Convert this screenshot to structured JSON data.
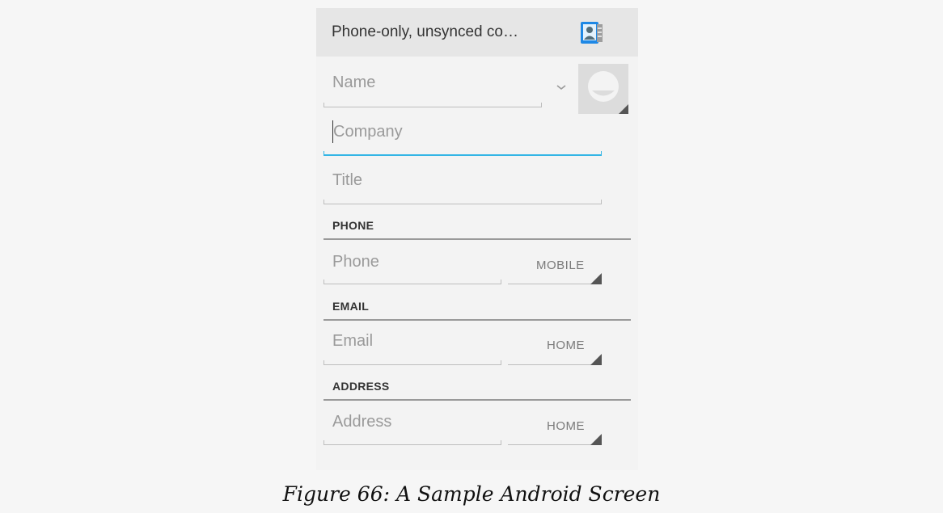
{
  "account": {
    "label": "Phone-only, unsynced co…",
    "icon": "contact-card-icon"
  },
  "fields": {
    "name_placeholder": "Name",
    "company_placeholder": "Company",
    "title_placeholder": "Title"
  },
  "sections": {
    "phone": {
      "header": "PHONE",
      "placeholder": "Phone",
      "type": "MOBILE"
    },
    "email": {
      "header": "EMAIL",
      "placeholder": "Email",
      "type": "HOME"
    },
    "address": {
      "header": "ADDRESS",
      "placeholder": "Address",
      "type": "HOME"
    }
  },
  "caption": "Figure 66: A Sample Android Screen",
  "colors": {
    "focus": "#33b5e5",
    "account_bar": "#e6e6e6",
    "icon_blue": "#1e88e5"
  }
}
